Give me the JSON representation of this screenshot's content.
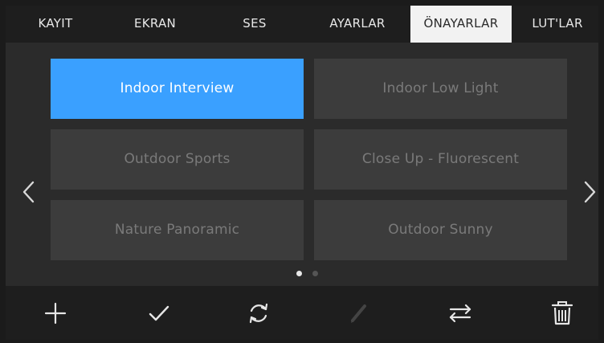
{
  "tabs": [
    {
      "label": "KAYIT"
    },
    {
      "label": "EKRAN"
    },
    {
      "label": "SES"
    },
    {
      "label": "AYARLAR"
    },
    {
      "label": "ÖNAYARLAR"
    },
    {
      "label": "LUT'LAR"
    }
  ],
  "active_tab": "ÖNAYARLAR",
  "presets": [
    {
      "label": "Indoor Interview",
      "selected": true
    },
    {
      "label": "Indoor Low Light",
      "selected": false
    },
    {
      "label": "Outdoor Sports",
      "selected": false
    },
    {
      "label": "Close Up - Fluorescent",
      "selected": false
    },
    {
      "label": "Nature Panoramic",
      "selected": false
    },
    {
      "label": "Outdoor Sunny",
      "selected": false
    }
  ],
  "pagination": {
    "current_page": 1,
    "total_pages": 2
  },
  "toolbar": {
    "icons": [
      "plus-icon",
      "checkmark-icon",
      "refresh-icon",
      "pencil-icon",
      "swap-arrows-icon",
      "trash-icon"
    ],
    "disabled": [
      "pencil-icon"
    ]
  },
  "colors": {
    "accent": "#3aa0ff",
    "tab_active_bg": "#f2f2f2",
    "panel_bg": "#2b2b2b",
    "bar_bg": "#1e1e1e",
    "preset_bg": "#3c3c3c"
  }
}
